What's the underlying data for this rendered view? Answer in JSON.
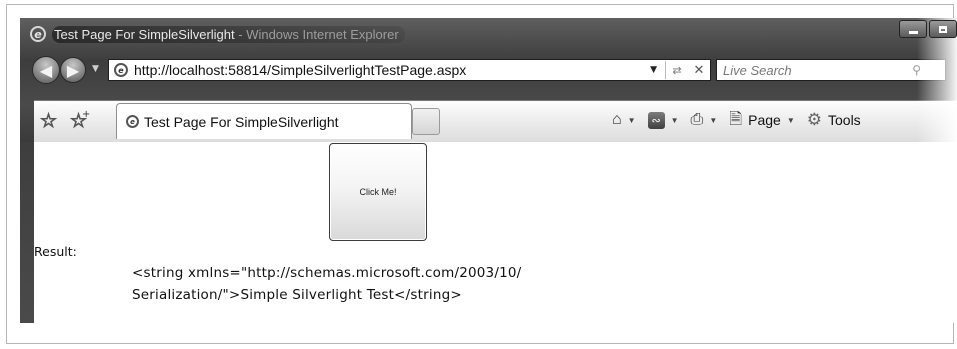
{
  "window": {
    "title": "Test Page For SimpleSilverlight - Windows Internet Explorer",
    "title_main": "Test Page For SimpleSilverlight",
    "title_suffix": " - Windows Internet Explorer"
  },
  "navigation": {
    "address_url": "http://localhost:58814/SimpleSilverlightTestPage.aspx",
    "search_placeholder": "Live Search"
  },
  "tabs": [
    {
      "label": "Test Page For SimpleSilverlight",
      "active": true
    }
  ],
  "command_bar": {
    "page_label": "Page",
    "tools_label": "Tools",
    "icons": [
      "home-icon",
      "feeds-icon",
      "print-icon",
      "page-icon",
      "gear-icon"
    ]
  },
  "content": {
    "button_label": "Click Me!",
    "result_label": "Result:",
    "result_line1": "<string xmlns=\"http://schemas.microsoft.com/2003/10/",
    "result_line2": "Serialization/\">Simple Silverlight Test</string>"
  }
}
